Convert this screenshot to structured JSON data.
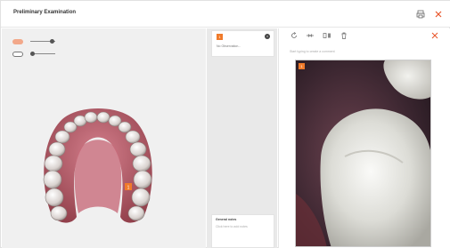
{
  "header": {
    "title": "Preliminary Examination"
  },
  "middle": {
    "note": {
      "badge_number": "1",
      "placeholder": "No Observation..."
    },
    "general_notes": {
      "label": "General notes",
      "placeholder": "Click here to add notes"
    }
  },
  "right_panel": {
    "hint": "Start typing to create a comment",
    "photo_badge": "1"
  },
  "icons": {
    "print": "print-icon",
    "close": "close-icon",
    "rotate": "rotate-icon",
    "compare": "compare-icon",
    "flip": "flip-icon",
    "delete": "trash-icon",
    "tooth_slider": "tooth-icon",
    "jaw_slider": "jaw-icon"
  },
  "colors": {
    "accent": "#f07a2a",
    "close": "#e8552a"
  }
}
